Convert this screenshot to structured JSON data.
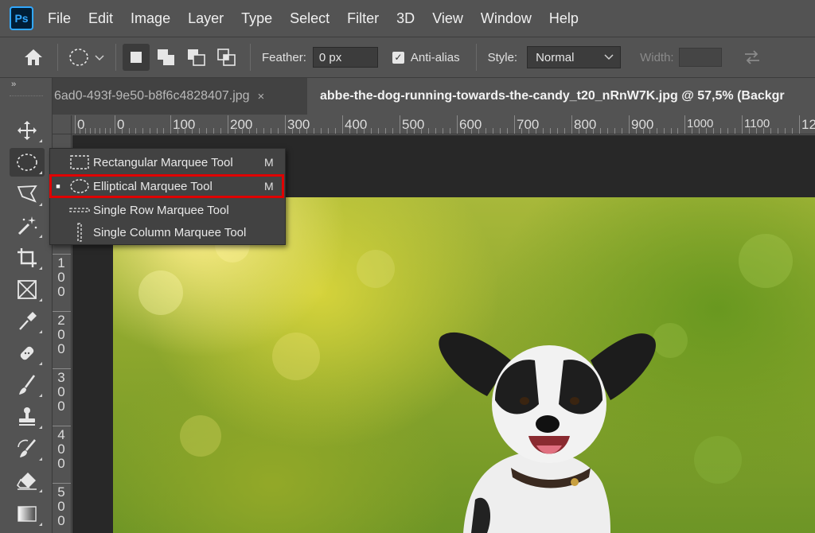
{
  "app": {
    "logo": "Ps"
  },
  "menu": [
    "File",
    "Edit",
    "Image",
    "Layer",
    "Type",
    "Select",
    "Filter",
    "3D",
    "View",
    "Window",
    "Help"
  ],
  "options": {
    "feather_label": "Feather:",
    "feather_value": "0 px",
    "antialias_label": "Anti-alias",
    "antialias_checked": true,
    "style_label": "Style:",
    "style_value": "Normal",
    "width_label": "Width:"
  },
  "tabs": [
    {
      "label": "6ad0-493f-9e50-b8f6c4828407.jpg",
      "close": "×",
      "active": false
    },
    {
      "label": "abbe-the-dog-running-towards-the-candy_t20_nRnW7K.jpg @ 57,5% (Backgr",
      "active": true
    }
  ],
  "rulers": {
    "horizontal": [
      "0",
      "0",
      "100",
      "200",
      "300",
      "400",
      "500",
      "600",
      "700",
      "800",
      "900",
      "1000",
      "1100",
      "120"
    ],
    "vertical": [
      [
        "1",
        "0",
        "0"
      ],
      [
        "2",
        "0",
        "0"
      ],
      [
        "3",
        "0",
        "0"
      ],
      [
        "4",
        "0",
        "0"
      ],
      [
        "5",
        "0",
        "0"
      ]
    ]
  },
  "flyout": {
    "items": [
      {
        "label": "Rectangular Marquee Tool",
        "shortcut": "M",
        "icon": "rect-marquee-icon",
        "selected": false
      },
      {
        "label": "Elliptical Marquee Tool",
        "shortcut": "M",
        "icon": "ellipse-marquee-icon",
        "selected": true
      },
      {
        "label": "Single Row Marquee Tool",
        "shortcut": "",
        "icon": "single-row-marquee-icon",
        "selected": false
      },
      {
        "label": "Single Column Marquee Tool",
        "shortcut": "",
        "icon": "single-column-marquee-icon",
        "selected": false
      }
    ],
    "selected_bullet": "■",
    "highlight_color": "#e00000"
  },
  "tools": [
    "move-icon",
    "elliptical-marquee-icon",
    "lasso-icon",
    "magic-wand-icon",
    "crop-icon",
    "frame-icon",
    "eyedropper-icon",
    "healing-brush-icon",
    "brush-icon",
    "clone-stamp-icon",
    "history-brush-icon",
    "eraser-icon",
    "gradient-icon"
  ],
  "colors": {
    "panel": "#535353",
    "tabbar": "#424242",
    "canvas_bg": "#282828",
    "accent": "#31a8ff"
  }
}
